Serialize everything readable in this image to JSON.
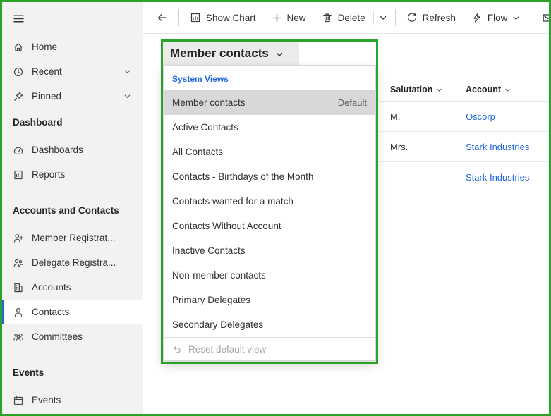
{
  "colors": {
    "annotation_green": "#2aa32a",
    "link_blue": "#2266e3",
    "selected_indicator_blue": "#2266e3",
    "sidebar_background": "#f3f2f1",
    "selected_view_background": "#d8d8d8"
  },
  "command_bar": {
    "buttons": [
      {
        "label": "Show Chart",
        "icon": "chart-icon"
      },
      {
        "label": "New",
        "icon": "plus-icon"
      },
      {
        "label": "Delete",
        "icon": "trash-icon",
        "has_dropdown": true
      },
      {
        "label": "Refresh",
        "icon": "refresh-icon"
      },
      {
        "label": "Flow",
        "icon": "flow-icon",
        "has_dropdown": true
      }
    ]
  },
  "sidebar": {
    "top_items": [
      {
        "label": "Home",
        "icon": "home-icon"
      },
      {
        "label": "Recent",
        "icon": "clock-icon",
        "expandable": true
      },
      {
        "label": "Pinned",
        "icon": "pin-icon",
        "expandable": true
      }
    ],
    "sections": [
      {
        "title": "Dashboard",
        "items": [
          {
            "label": "Dashboards",
            "icon": "dashboard-icon"
          },
          {
            "label": "Reports",
            "icon": "report-icon"
          }
        ]
      },
      {
        "title": "Accounts and Contacts",
        "items": [
          {
            "label": "Member Registrat...",
            "icon": "person-add-icon"
          },
          {
            "label": "Delegate Registra...",
            "icon": "people-icon"
          },
          {
            "label": "Accounts",
            "icon": "building-icon"
          },
          {
            "label": "Contacts",
            "icon": "person-icon",
            "selected": true
          },
          {
            "label": "Committees",
            "icon": "people-group-icon"
          }
        ]
      },
      {
        "title": "Events",
        "items": [
          {
            "label": "Events",
            "icon": "calendar-icon"
          }
        ]
      }
    ]
  },
  "view_selector": {
    "title": "Member contacts",
    "group_header": "System Views",
    "views": [
      {
        "label": "Member contacts",
        "badge": "Default",
        "selected": true
      },
      {
        "label": "Active Contacts"
      },
      {
        "label": "All Contacts"
      },
      {
        "label": "Contacts - Birthdays of the Month"
      },
      {
        "label": "Contacts wanted for a match"
      },
      {
        "label": "Contacts Without Account"
      },
      {
        "label": "Inactive Contacts"
      },
      {
        "label": "Non-member contacts"
      },
      {
        "label": "Primary Delegates"
      },
      {
        "label": "Secondary Delegates"
      }
    ],
    "footer": "Reset default view"
  },
  "grid": {
    "columns": [
      "Salutation",
      "Account"
    ],
    "rows": [
      {
        "salutation": "M.",
        "account": "Oscorp"
      },
      {
        "salutation": "Mrs.",
        "account": "Stark Industries"
      },
      {
        "salutation": "",
        "account": "Stark Industries"
      }
    ]
  }
}
